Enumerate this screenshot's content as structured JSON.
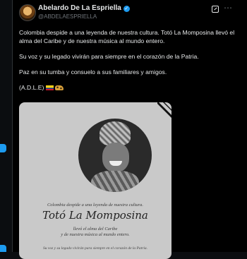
{
  "tweet": {
    "author_name": "Abelardo De La Espriella",
    "author_handle": "@ABDELAESPRIELLA",
    "paragraphs": [
      "Colombia despide a una leyenda de nuestra cultura. Totó La Momposina llevó el alma del Caribe y de nuestra música al mundo entero.",
      "Su voz y su legado vivirán para siempre en el corazón de la Patria.",
      "Paz en su tumba y consuelo a sus familiares y amigos."
    ],
    "signature": "(A.D.L.E)"
  },
  "card": {
    "line1": "Colombia despide a una leyenda de nuestra cultura.",
    "script_name": "Totó La Momposina",
    "line2a": "llevó el alma del Caribe",
    "line2b": "y de nuestra música al mundo entero.",
    "line3": "Su voz y su legado vivirán para siempre en el corazón de la Patria."
  },
  "icons": {
    "verified": "verified-badge-icon",
    "grok": "grok-icon",
    "more": "more-options-icon",
    "flag": "colombia-flag-emoji",
    "leopard": "leopard-emoji",
    "ribbon": "mourning-ribbon-icon"
  },
  "colors": {
    "accent": "#1d9bf0",
    "background": "#000000",
    "text": "#e7e9ea",
    "muted": "#71767b"
  }
}
